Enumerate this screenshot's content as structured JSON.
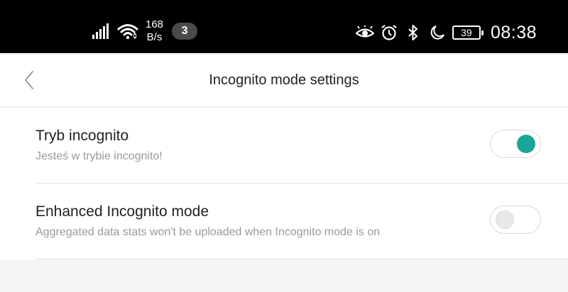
{
  "status_bar": {
    "net_speed_value": "168",
    "net_speed_unit": "B/s",
    "notification_count": "3",
    "battery_level": "39",
    "time": "08:38",
    "icons": [
      "signal-icon",
      "wifi-icon",
      "eye-comfort-icon",
      "alarm-icon",
      "bluetooth-icon",
      "do-not-disturb-moon-icon",
      "battery-icon"
    ]
  },
  "header": {
    "title": "Incognito mode settings",
    "back_icon": "chevron-left-icon"
  },
  "settings": [
    {
      "title": "Tryb incognito",
      "subtitle": "Jesteś w trybie incognito!",
      "enabled": true
    },
    {
      "title": "Enhanced Incognito mode",
      "subtitle": "Aggregated data stats won't be uploaded when Incognito mode is on",
      "enabled": false
    }
  ],
  "colors": {
    "accent": "#1aa596",
    "status_bar_bg": "#000000",
    "background": "#f5f5f5"
  }
}
